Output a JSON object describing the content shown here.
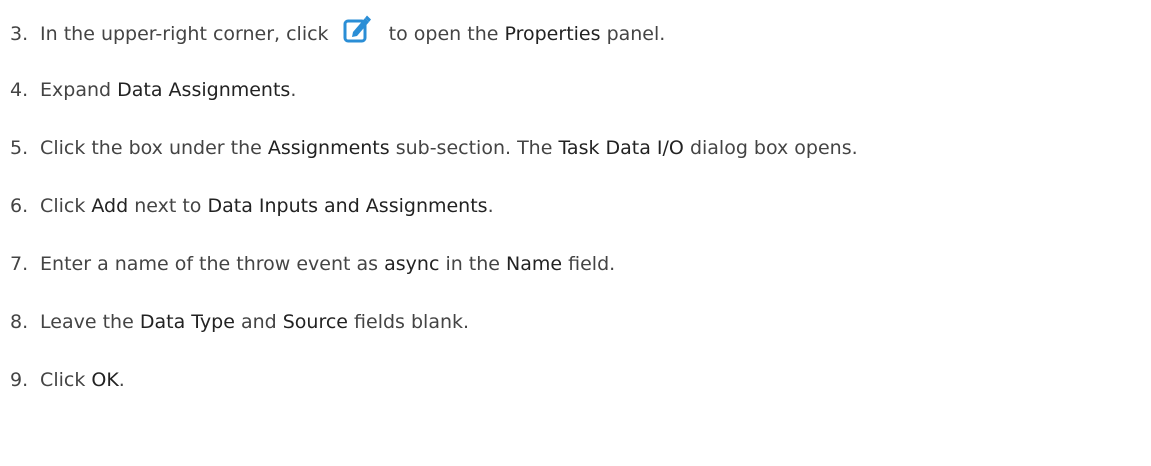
{
  "steps": [
    {
      "num": "3.",
      "t1": "In the upper-right corner, click",
      "t2": "to open the",
      "b1": "Properties",
      "t3": "panel.",
      "icon": "edit-icon"
    },
    {
      "num": "4.",
      "t1": "Expand",
      "b1": "Data Assignments",
      "t2": "."
    },
    {
      "num": "5.",
      "t1": "Click the box under the",
      "b1": "Assignments",
      "t2": "sub-section. The",
      "b2": "Task Data I/O",
      "t3": "dialog box opens."
    },
    {
      "num": "6.",
      "t1": "Click",
      "b1": "Add",
      "t2": "next to",
      "b2": "Data Inputs and Assignments",
      "t3": "."
    },
    {
      "num": "7.",
      "t1": "Enter a name of the throw event as",
      "b1": "async",
      "t2": "in the",
      "b2": "Name",
      "t3": "field."
    },
    {
      "num": "8.",
      "t1": "Leave the",
      "b1": "Data Type",
      "t2": "and",
      "b2": "Source",
      "t3": "fields blank."
    },
    {
      "num": "9.",
      "t1": "Click",
      "b1": "OK",
      "t2": "."
    }
  ],
  "colors": {
    "text": "#444444",
    "emphasis": "#222222",
    "icon": "#2a8ed6"
  }
}
